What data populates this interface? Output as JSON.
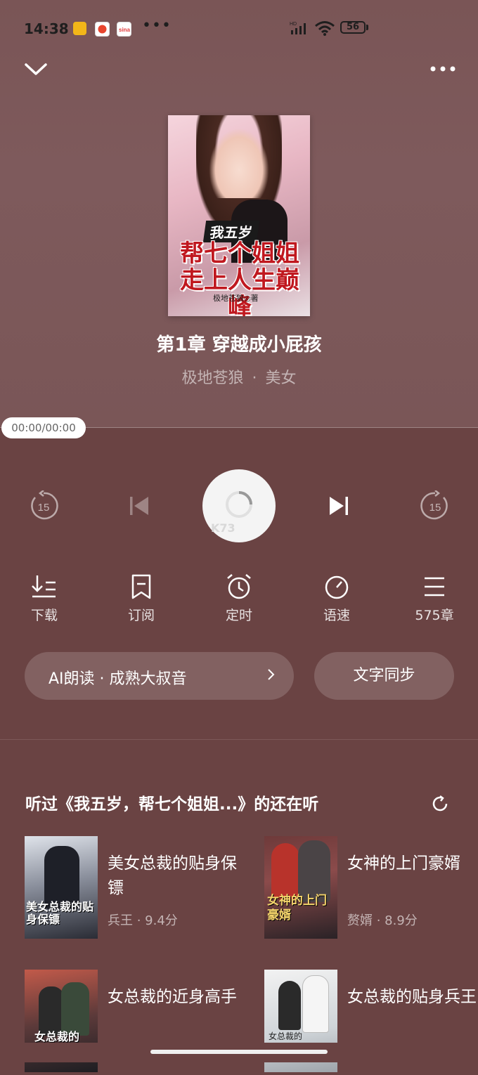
{
  "status_bar": {
    "time": "14:38",
    "network": "HD",
    "battery": "56",
    "app_icon_colors": [
      "#f2b619",
      "#e8452e",
      "#e23b3b"
    ]
  },
  "nav": {
    "collapse_icon": "chevron-down-icon",
    "more_icon": "more-horizontal-icon"
  },
  "cover": {
    "subtitle": "我五岁",
    "title_line1": "帮七个姐姐",
    "title_line2": "走上人生巅峰",
    "author_text": "极地苍狼◎著"
  },
  "player": {
    "chapter_title": "第1章 穿越成小屁孩",
    "author": "极地苍狼",
    "category": "美女",
    "separator": "·",
    "time_display": "00:00/00:00",
    "watermark": "K73"
  },
  "functions": [
    {
      "label": "下载",
      "icon": "download-icon"
    },
    {
      "label": "订阅",
      "icon": "bookmark-icon"
    },
    {
      "label": "定时",
      "icon": "alarm-clock-icon"
    },
    {
      "label": "语速",
      "icon": "speed-dial-icon"
    },
    {
      "label": "575章",
      "icon": "list-icon"
    }
  ],
  "voice": {
    "label": "AI朗读 · 成熟大叔音"
  },
  "sync": {
    "label": "文字同步"
  },
  "recommend": {
    "heading": "听过《我五岁，帮七个姐姐...》的还在听",
    "items": [
      {
        "title": "美女总裁的贴身保镖",
        "author": "兵王",
        "score": "9.4分",
        "cover_text": "美女总裁的贴身保镖"
      },
      {
        "title": "女神的上门豪婿",
        "author": "赘婿",
        "score": "8.9分",
        "cover_text": "女神的上门豪婿"
      },
      {
        "title": "女总裁的近身高手",
        "cover_text": "女总裁的"
      },
      {
        "title": "女总裁的贴身兵王",
        "cover_text": "女总裁的"
      }
    ]
  },
  "colors": {
    "background": "#6a4343",
    "header": "#7a5556",
    "accent_red": "#c0181f"
  }
}
